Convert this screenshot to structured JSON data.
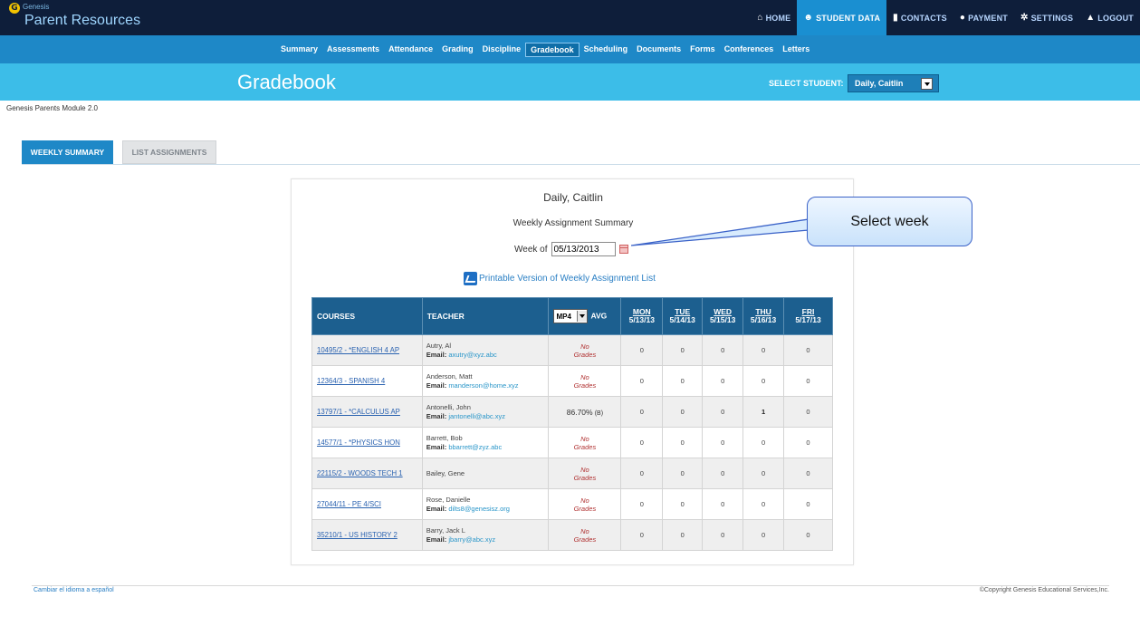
{
  "app": {
    "logo_small": "Genesis",
    "title": "Parent Resources"
  },
  "topnav": [
    {
      "label": "HOME",
      "icon": "home-icon"
    },
    {
      "label": "STUDENT DATA",
      "icon": "users-icon",
      "active": true
    },
    {
      "label": "CONTACTS",
      "icon": "contacts-icon"
    },
    {
      "label": "PAYMENT",
      "icon": "payment-icon"
    },
    {
      "label": "SETTINGS",
      "icon": "gear-icon"
    },
    {
      "label": "LOGOUT",
      "icon": "lock-icon"
    }
  ],
  "subnav": [
    "Summary",
    "Assessments",
    "Attendance",
    "Grading",
    "Discipline",
    "Gradebook",
    "Scheduling",
    "Documents",
    "Forms",
    "Conferences",
    "Letters"
  ],
  "subnav_active": "Gradebook",
  "page_title": "Gradebook",
  "select_student": {
    "label": "SELECT STUDENT:",
    "value": "Daily, Caitlin"
  },
  "module_label": "Genesis Parents Module 2.0",
  "tabs": {
    "weekly": "WEEKLY SUMMARY",
    "list": "LIST ASSIGNMENTS"
  },
  "summary": {
    "student": "Daily, Caitlin",
    "title": "Weekly Assignment Summary",
    "week_label": "Week of",
    "week_value": "05/13/2013",
    "printable": "Printable Version of Weekly Assignment List"
  },
  "callout": "Select week",
  "table": {
    "headers": {
      "courses": "COURSES",
      "teacher": "TEACHER",
      "mp": "MP4",
      "avg": "AVG"
    },
    "days": [
      {
        "name": "MON",
        "date": "5/13/13"
      },
      {
        "name": "TUE",
        "date": "5/14/13"
      },
      {
        "name": "WED",
        "date": "5/15/13"
      },
      {
        "name": "THU",
        "date": "5/16/13"
      },
      {
        "name": "FRI",
        "date": "5/17/13"
      }
    ],
    "rows": [
      {
        "course": "10495/2 - *ENGLISH 4 AP",
        "teacher": "Autry, Al",
        "email": "axutry@xyz.abc",
        "avg_pct": "",
        "avg_letter": "",
        "no_grades": [
          "No",
          "Grades"
        ],
        "days": [
          "0",
          "0",
          "0",
          "0",
          "0"
        ]
      },
      {
        "course": "12364/3 - SPANISH 4",
        "teacher": "Anderson, Matt",
        "email": "manderson@home.xyz",
        "avg_pct": "",
        "avg_letter": "",
        "no_grades": [
          "No",
          "Grades"
        ],
        "days": [
          "0",
          "0",
          "0",
          "0",
          "0"
        ]
      },
      {
        "course": "13797/1 - *CALCULUS AP",
        "teacher": "Antonelli, John",
        "email": "jantonelli@abc.xyz",
        "avg_pct": "86.70%",
        "avg_letter": "(B)",
        "no_grades": [
          "",
          ""
        ],
        "days": [
          "0",
          "0",
          "0",
          "1",
          "0"
        ]
      },
      {
        "course": "14577/1 - *PHYSICS HON",
        "teacher": "Barrett, Bob",
        "email": "bbarrett@zyz.abc",
        "avg_pct": "",
        "avg_letter": "",
        "no_grades": [
          "No",
          "Grades"
        ],
        "days": [
          "0",
          "0",
          "0",
          "0",
          "0"
        ]
      },
      {
        "course": "22115/2 - WOODS TECH 1",
        "teacher": "Bailey, Gene",
        "email": "",
        "avg_pct": "",
        "avg_letter": "",
        "no_grades": [
          "No",
          "Grades"
        ],
        "days": [
          "0",
          "0",
          "0",
          "0",
          "0"
        ]
      },
      {
        "course": "27044/11 - PE 4/SCI",
        "teacher": "Rose, Danielle",
        "email": "dilts8@genesisz.org",
        "avg_pct": "",
        "avg_letter": "",
        "no_grades": [
          "No",
          "Grades"
        ],
        "days": [
          "0",
          "0",
          "0",
          "0",
          "0"
        ]
      },
      {
        "course": "35210/1 - US HISTORY 2",
        "teacher": "Barry, Jack L",
        "email": "jbarry@abc.xyz",
        "avg_pct": "",
        "avg_letter": "",
        "no_grades": [
          "No",
          "Grades"
        ],
        "days": [
          "0",
          "0",
          "0",
          "0",
          "0"
        ]
      }
    ],
    "email_label": "Email:"
  },
  "footer": {
    "language": "Cambiar el idioma a español",
    "copyright": "©Copyright Genesis Educational Services,Inc."
  }
}
